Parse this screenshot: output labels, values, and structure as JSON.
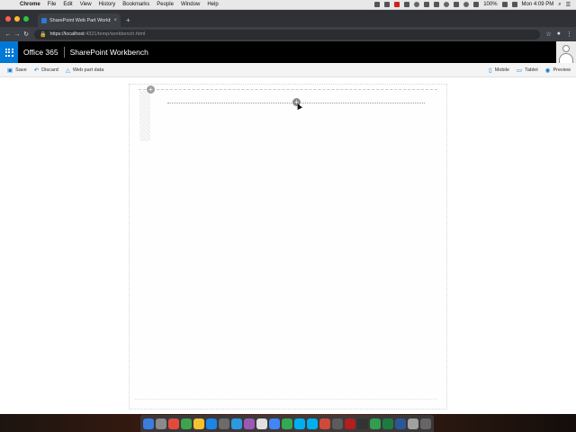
{
  "menubar": {
    "app": "Chrome",
    "items": [
      "File",
      "Edit",
      "View",
      "History",
      "Bookmarks",
      "People",
      "Window",
      "Help"
    ],
    "battery": "100%",
    "clock": "Mon 4:09 PM"
  },
  "browser": {
    "tab_title": "SharePoint Web Part Workben",
    "tab_close": "×",
    "new_tab": "+",
    "url_host": "https://localhost",
    "url_path": ":4321/temp/workbench.html",
    "colors": {
      "close": "#ff5f57",
      "minimize": "#febc2e",
      "zoom": "#28c840"
    }
  },
  "suitebar": {
    "brand": "Office 365",
    "app_name": "SharePoint Workbench",
    "accent": "#0078d7"
  },
  "commandbar": {
    "save": "Save",
    "discard": "Discard",
    "webpart_data": "Web part data",
    "mobile": "Mobile",
    "tablet": "Tablet",
    "preview": "Preview"
  },
  "canvas": {
    "add_section": "+",
    "add_webpart": "+"
  },
  "dock": {
    "apps": [
      "#3b7ddd",
      "#8a8a8a",
      "#e24b3b",
      "#3fa34d",
      "#f2c230",
      "#1b86e8",
      "#6b6b6b",
      "#2b9ae0",
      "#9b59b6",
      "#e0e0e0",
      "#4285f4",
      "#34a853",
      "#00aff0",
      "#00aff0",
      "#d04a3a",
      "#5c5c5c",
      "#b31e1e",
      "#333333",
      "#2f9e4e",
      "#1f7a3f",
      "#2b5797",
      "#a0a0a0",
      "#666666"
    ]
  }
}
